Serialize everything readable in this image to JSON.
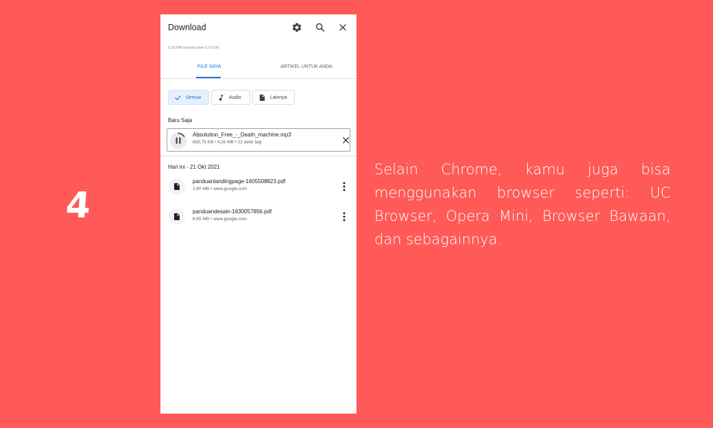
{
  "slide": {
    "step_number": "4",
    "caption": "Selain Chrome, kamu juga bisa menggunakan browser seperti: UC Browser, Opera Mini, Browser Bawaan, dan sebagainnya."
  },
  "header": {
    "title": "Download",
    "icons": [
      "gear-icon",
      "search-icon",
      "close-icon"
    ]
  },
  "storage_info": "8,33 MB terpakai dari 9,70 GB",
  "tabs": [
    {
      "label": "FILE SAYA",
      "active": true
    },
    {
      "label": "ARTIKEL UNTUK ANDA",
      "active": false
    }
  ],
  "filters": [
    {
      "label": "Semua",
      "icon": "check-icon",
      "selected": true
    },
    {
      "label": "Audio",
      "icon": "music-note-icon",
      "selected": false
    },
    {
      "label": "Lainnya",
      "icon": "document-icon",
      "selected": false
    }
  ],
  "recent": {
    "label": "Baru Saja",
    "item": {
      "name": "Absolution_Free_-_Death_machine.mp3",
      "meta": "655,75 KB / 4,26 MB • 22 detik lagi",
      "progress": 0.15
    }
  },
  "today": {
    "label": "Hari ini - 21 Okt 2021",
    "items": [
      {
        "name": "panduanlandingpage-1605508823.pdf",
        "meta": "1,80 MB • www.google.com"
      },
      {
        "name": "panduandesain-1630057856.pdf",
        "meta": "6,65 MB • www.google.com"
      }
    ]
  },
  "colors": {
    "background": "#ff5a57",
    "accent": "#1a73e8"
  }
}
